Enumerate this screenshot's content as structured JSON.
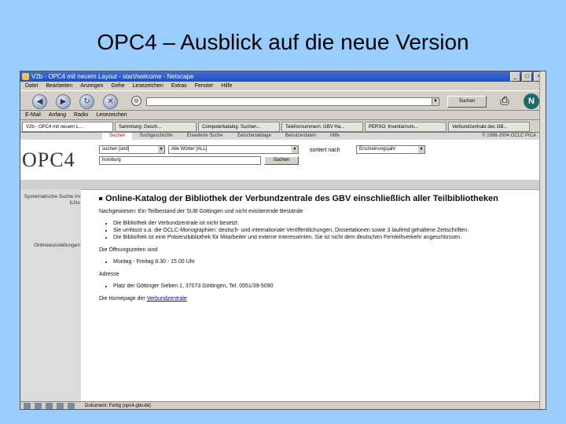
{
  "slide": {
    "title": "OPC4 – Ausblick auf die neue Version"
  },
  "browser": {
    "title": "V2b - OPC4 mit neuem Layout - start/welcome - Netscape",
    "menu": [
      "Datei",
      "Bearbeiten",
      "Anzeigen",
      "Gehe",
      "Lesezeichen",
      "Extras",
      "Fenster",
      "Hilfe"
    ],
    "url_value": "",
    "search_button": "Suchen",
    "personal_toolbar": [
      "E-Mail",
      "Anfang",
      "Radio",
      "Lesezeichen"
    ],
    "tabs": [
      "V2b - OPC4 mit neuem L...",
      "Sammlung: Gesch...",
      "Computerkatalog: Suchen...",
      "Telefonnummern: GBV Ha...",
      "PERSO: Inventarnum...",
      "Verbundzentrale des GB..."
    ],
    "status_text": "Dokument: Fertig (opc4.gbv.de)"
  },
  "opc": {
    "nav": [
      "Suchen",
      "Suchgeschichte",
      "Erweiterte Suche",
      "Zwischenablage",
      "Benutzerdaten",
      "Hilfe"
    ],
    "copyright": "© 1998-2004 OCLC PICA",
    "logo": "OPC4",
    "search_field_select": "suchen [und]",
    "search_index_select": "Alle Wörter [ALL]",
    "sort_label": "sortiert nach",
    "sort_select": "Erscheinungsjahr",
    "search_term": "homburg",
    "search_button": "Suchen",
    "sidebar": [
      "Systematische Suche im ILNs",
      "Onlineausstellungen"
    ],
    "heading": "Online-Katalog der Bibliothek der Verbundzentrale des GBV einschließlich aller Teilbibliotheken",
    "nachgewiesen": "Nachgewiesen: Ein Teilbestand der SUB Göttingen und nicht existierende Bestände",
    "bullets1": [
      "Die Bibliothek der Verbundzentrale ist nicht besetzt.",
      "Sie umfasst u.a. die OCLC-Monographien: deutsch- und internationale Veröffentlichungen, Dissertationen sowie 3 laufend gehaltene Zeitschriften.",
      "Die Bibliothek ist eine Präsenzbibliothek für Mitarbeiter und externe Interessenten. Sie ist nicht dem deutschen Fernleihverkehr angeschlossen."
    ],
    "bullet_bold": "Präsenzbibliothek",
    "hours_label": "Die Öffnungszeiten sind",
    "hours": "Montag - Freitag 8.30 - 15.00 Uhr",
    "address_label": "Adresse",
    "address": "Platz der Göttinger Sieben 1, 37073 Göttingen, Tel. 0551/39-5090",
    "homepage_prefix": "Die Homepage der ",
    "homepage_link": "Verbundzentrale"
  }
}
